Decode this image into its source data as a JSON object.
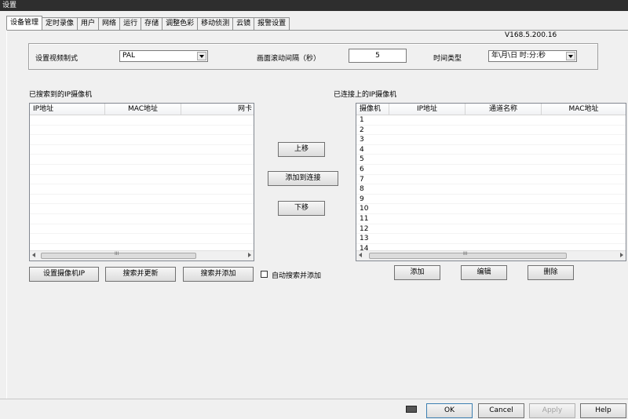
{
  "window": {
    "title": "设置"
  },
  "tabs": [
    "设备管理",
    "定时录像",
    "用户",
    "网络",
    "运行",
    "存储",
    "调整色彩",
    "移动侦测",
    "云镜",
    "报警设置"
  ],
  "version": "V168.5.200.16",
  "settings": {
    "video_standard_label": "设置视频制式",
    "video_standard_value": "PAL",
    "scroll_interval_label": "画面滚动间隔（秒）",
    "scroll_interval_value": "5",
    "time_type_label": "时间类型",
    "time_type_value": "年\\月\\日 时:分:秒"
  },
  "searched": {
    "title": "已搜索到的IP摄像机",
    "columns": [
      "IP地址",
      "MAC地址",
      "网卡"
    ],
    "rows": []
  },
  "connected": {
    "title": "已连接上的IP摄像机",
    "columns": [
      "摄像机",
      "IP地址",
      "通道名称",
      "MAC地址"
    ],
    "rows": [
      "1",
      "2",
      "3",
      "4",
      "5",
      "6",
      "7",
      "8",
      "9",
      "10",
      "11",
      "12",
      "13",
      "14"
    ]
  },
  "middle_buttons": {
    "up": "上移",
    "add_to_connected": "添加到连接",
    "down": "下移"
  },
  "left_buttons": {
    "set_camera_ip": "设置摄像机IP",
    "search_update": "搜索并更新",
    "search_add": "搜索并添加",
    "auto_search_add": "自动搜索并添加"
  },
  "right_buttons": {
    "add": "添加",
    "edit": "编辑",
    "delete": "删除"
  },
  "footer": {
    "ok": "OK",
    "cancel": "Cancel",
    "apply": "Apply",
    "help": "Help"
  },
  "scroll_grip": "III",
  "colors": {
    "apply_disabled": "#a0a0a0"
  }
}
